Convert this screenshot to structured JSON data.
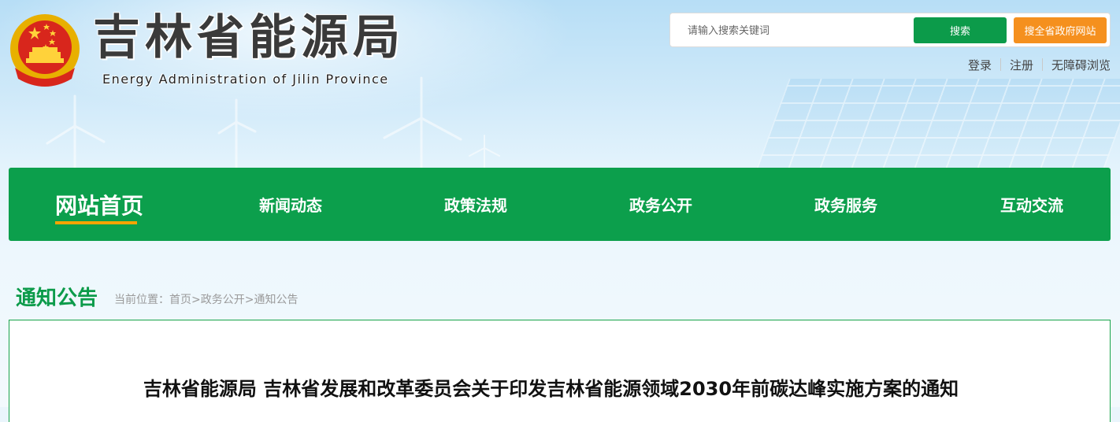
{
  "header": {
    "title_cn": "吉林省能源局",
    "title_en": "Energy Administration of Jilin Province",
    "emblem_icon": "national-emblem-icon"
  },
  "search": {
    "placeholder": "请输入搜索关键词",
    "button_label": "搜索",
    "province_button_label": "搜全省政府网站"
  },
  "top_links": [
    "登录",
    "注册",
    "无障碍浏览"
  ],
  "nav": {
    "items": [
      {
        "label": "网站首页",
        "active": true
      },
      {
        "label": "新闻动态"
      },
      {
        "label": "政策法规"
      },
      {
        "label": "政务公开"
      },
      {
        "label": "政务服务"
      },
      {
        "label": "互动交流"
      }
    ]
  },
  "section": {
    "title": "通知公告",
    "breadcrumb": "当前位置：首页>政务公开>通知公告"
  },
  "article": {
    "title": "吉林省能源局 吉林省发展和改革委员会关于印发吉林省能源领域2030年前碳达峰实施方案的通知"
  },
  "colors": {
    "brand_green": "#0c9f4c",
    "accent_orange": "#f5901e",
    "underline_gold": "#f7a400"
  }
}
